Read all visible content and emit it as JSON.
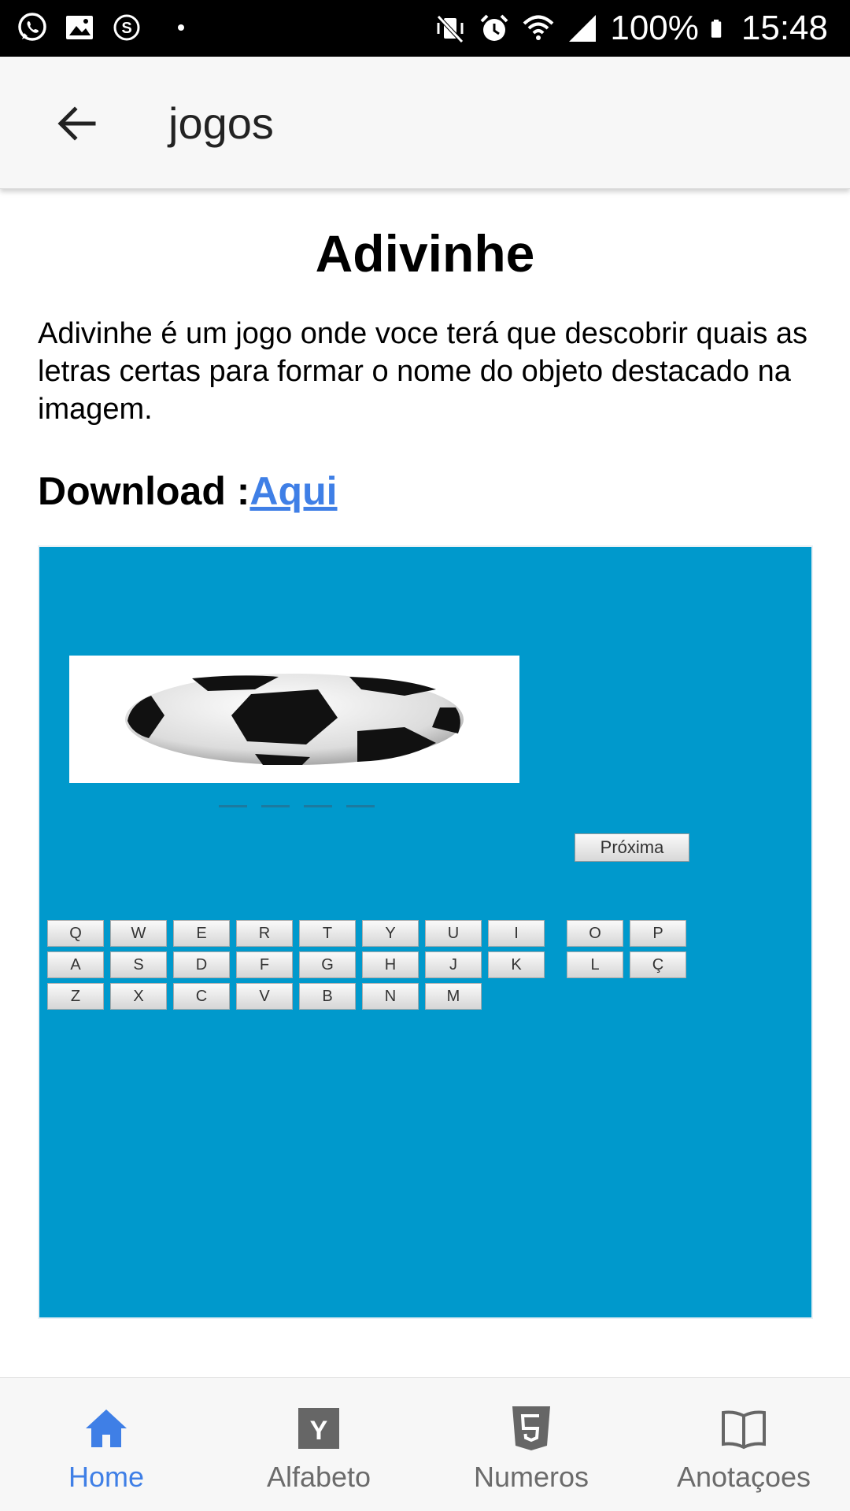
{
  "status_bar": {
    "battery": "100%",
    "time": "15:48"
  },
  "app_bar": {
    "title": "jogos"
  },
  "content": {
    "title": "Adivinhe",
    "description": "Adivinhe é um jogo onde voce terá que descobrir quais as letras certas para formar o nome do objeto destacado na imagem.",
    "download_label": "Download :",
    "download_link": "Aqui"
  },
  "game_screenshot": {
    "next_button": "Próxima",
    "keyboard": {
      "row1": [
        "Q",
        "W",
        "E",
        "R",
        "T",
        "Y",
        "U",
        "I",
        "O",
        "P"
      ],
      "row2": [
        "A",
        "S",
        "D",
        "F",
        "G",
        "H",
        "J",
        "K",
        "L",
        "Ç"
      ],
      "row3": [
        "Z",
        "X",
        "C",
        "V",
        "B",
        "N",
        "M"
      ]
    },
    "background_color": "#0099cc"
  },
  "bottom_nav": {
    "items": [
      {
        "label": "Home",
        "icon": "home-icon",
        "active": true
      },
      {
        "label": "Alfabeto",
        "icon": "y-letter-icon",
        "active": false
      },
      {
        "label": "Numeros",
        "icon": "html5-icon",
        "active": false
      },
      {
        "label": "Anotaçoes",
        "icon": "book-icon",
        "active": false
      }
    ],
    "active_color": "#3f7fe6",
    "inactive_color": "#6b6b6b"
  }
}
